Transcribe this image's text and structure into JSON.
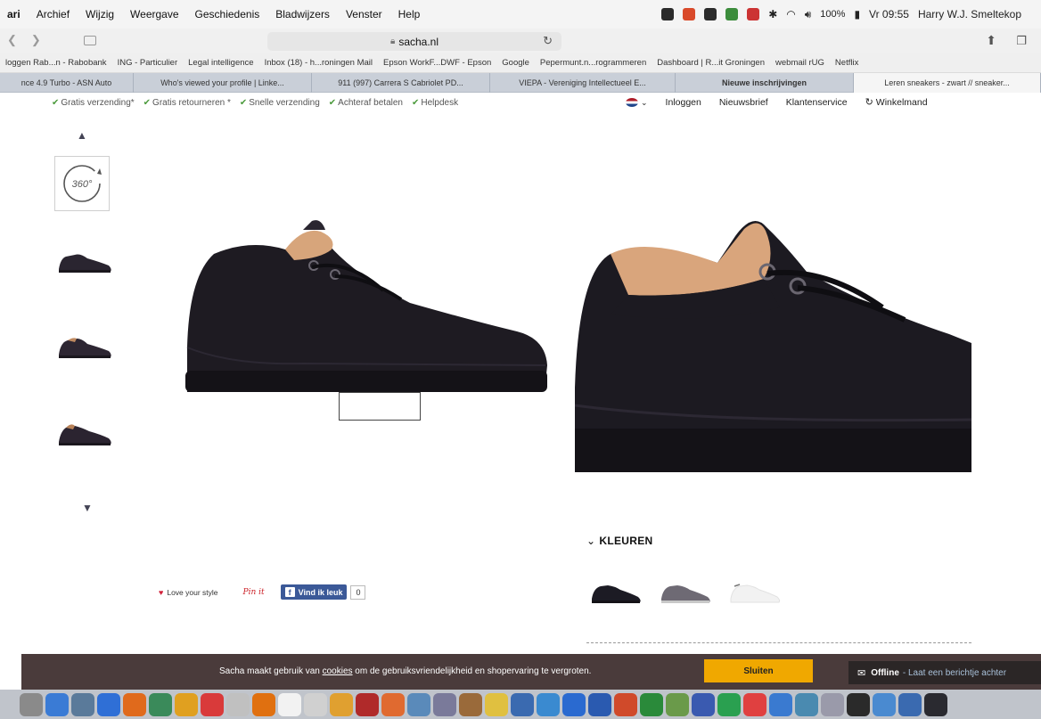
{
  "menubar": {
    "items": [
      "ari",
      "Archief",
      "Wijzig",
      "Weergave",
      "Geschiedenis",
      "Bladwijzers",
      "Venster",
      "Help"
    ],
    "battery": "100%",
    "clock": "Vr 09:55",
    "user": "Harry W.J. Smeltekop",
    "status_icon_colors": [
      "#2b2b2b",
      "#d94a2a",
      "#2b2b2b",
      "#3c8c3c",
      "#cc3333"
    ]
  },
  "toolbar": {
    "url": "sacha.nl"
  },
  "bookmarks": [
    "loggen Rab...n - Rabobank",
    "ING - Particulier",
    "Legal intelligence",
    "Inbox (18) - h...roningen Mail",
    "Epson WorkF...DWF - Epson",
    "Google",
    "Pepermunt.n...rogrammeren",
    "Dashboard | R...it Groningen",
    "webmail rUG",
    "Netflix"
  ],
  "tabs": [
    {
      "label": "nce 4.9 Turbo - ASN Auto",
      "width": 150
    },
    {
      "label": "Who's viewed your profile | Linke...",
      "width": 200
    },
    {
      "label": "911 (997) Carrera S Cabriolet PD...",
      "width": 200
    },
    {
      "label": "VIEPA - Vereniging Intellectueel E...",
      "width": 208
    },
    {
      "label": "Nieuwe inschrijvingen",
      "width": 200,
      "bold": true
    },
    {
      "label": "Leren sneakers - zwart // sneaker...",
      "width": 210,
      "active": true
    }
  ],
  "usps": [
    "Gratis verzending*",
    "Gratis retourneren *",
    "Snelle verzending",
    "Achteraf betalen",
    "Helpdesk"
  ],
  "sitenav": {
    "login": "Inloggen",
    "newsletter": "Nieuwsbrief",
    "service": "Klantenservice",
    "cart": "Winkelmand"
  },
  "gallery": {
    "badge_360": "360°"
  },
  "colours": {
    "title": "KLEUREN",
    "swatches": [
      "#1c1b24",
      "#6e6a74",
      "#f2f2f2"
    ]
  },
  "social": {
    "love": "Love your style",
    "pin": "Pin it",
    "fb_like": "Vind ik leuk",
    "fb_count": "0"
  },
  "cookie": {
    "text_before": "Sacha maakt gebruik van ",
    "link": "cookies",
    "text_after": " om de gebruiksvriendelijkheid en shopervaring te vergroten.",
    "button": "Sluiten"
  },
  "chat": {
    "status": "Offline",
    "message": "- Laat een berichtje achter"
  },
  "dock_colors": [
    "#8a8a8a",
    "#3a7bd5",
    "#5a7a9a",
    "#2f6fd6",
    "#e06a1c",
    "#3a8a5a",
    "#e0a020",
    "#d93a3a",
    "#c0c0c0",
    "#e07010",
    "#f2f2f2",
    "#d0d0d0",
    "#e0a030",
    "#b02a2a",
    "#e06a30",
    "#5a8aba",
    "#7a7a9a",
    "#9a6a3a",
    "#e0c040",
    "#3a6ab0",
    "#3a8ad0",
    "#2a6ad0",
    "#2a5ab0",
    "#d04a2a",
    "#2a8a3a",
    "#6a9a4a",
    "#3a5ab0",
    "#2aa050",
    "#e04040",
    "#3a7ad0",
    "#4a8ab0",
    "#9a9aaa",
    "#2a2a2a",
    "#4a8ad0",
    "#3a6ab0",
    "#2a2a30"
  ]
}
